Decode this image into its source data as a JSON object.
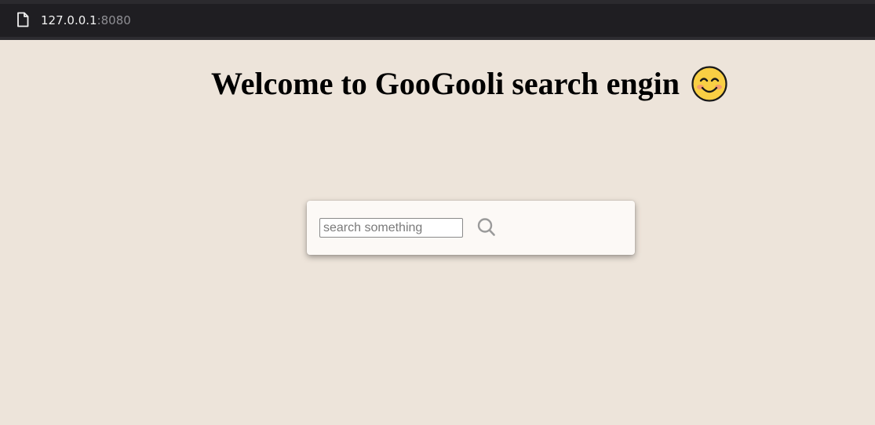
{
  "browser": {
    "address_host": "127.0.0.1",
    "address_port": ":8080",
    "page_icon": "file-icon",
    "nav_icon": "back-icon"
  },
  "main": {
    "heading": "Welcome to GooGooli search engin",
    "heading_emoji": "smiling-face-icon"
  },
  "search": {
    "placeholder": "search something",
    "value": "",
    "button_icon": "search-icon"
  },
  "colors": {
    "background": "#ede4da",
    "card": "#fcf9f6",
    "browser_bar": "#1f1e22",
    "icon_gray": "#9a9a9a",
    "emoji_yellow": "#f9cf44"
  }
}
